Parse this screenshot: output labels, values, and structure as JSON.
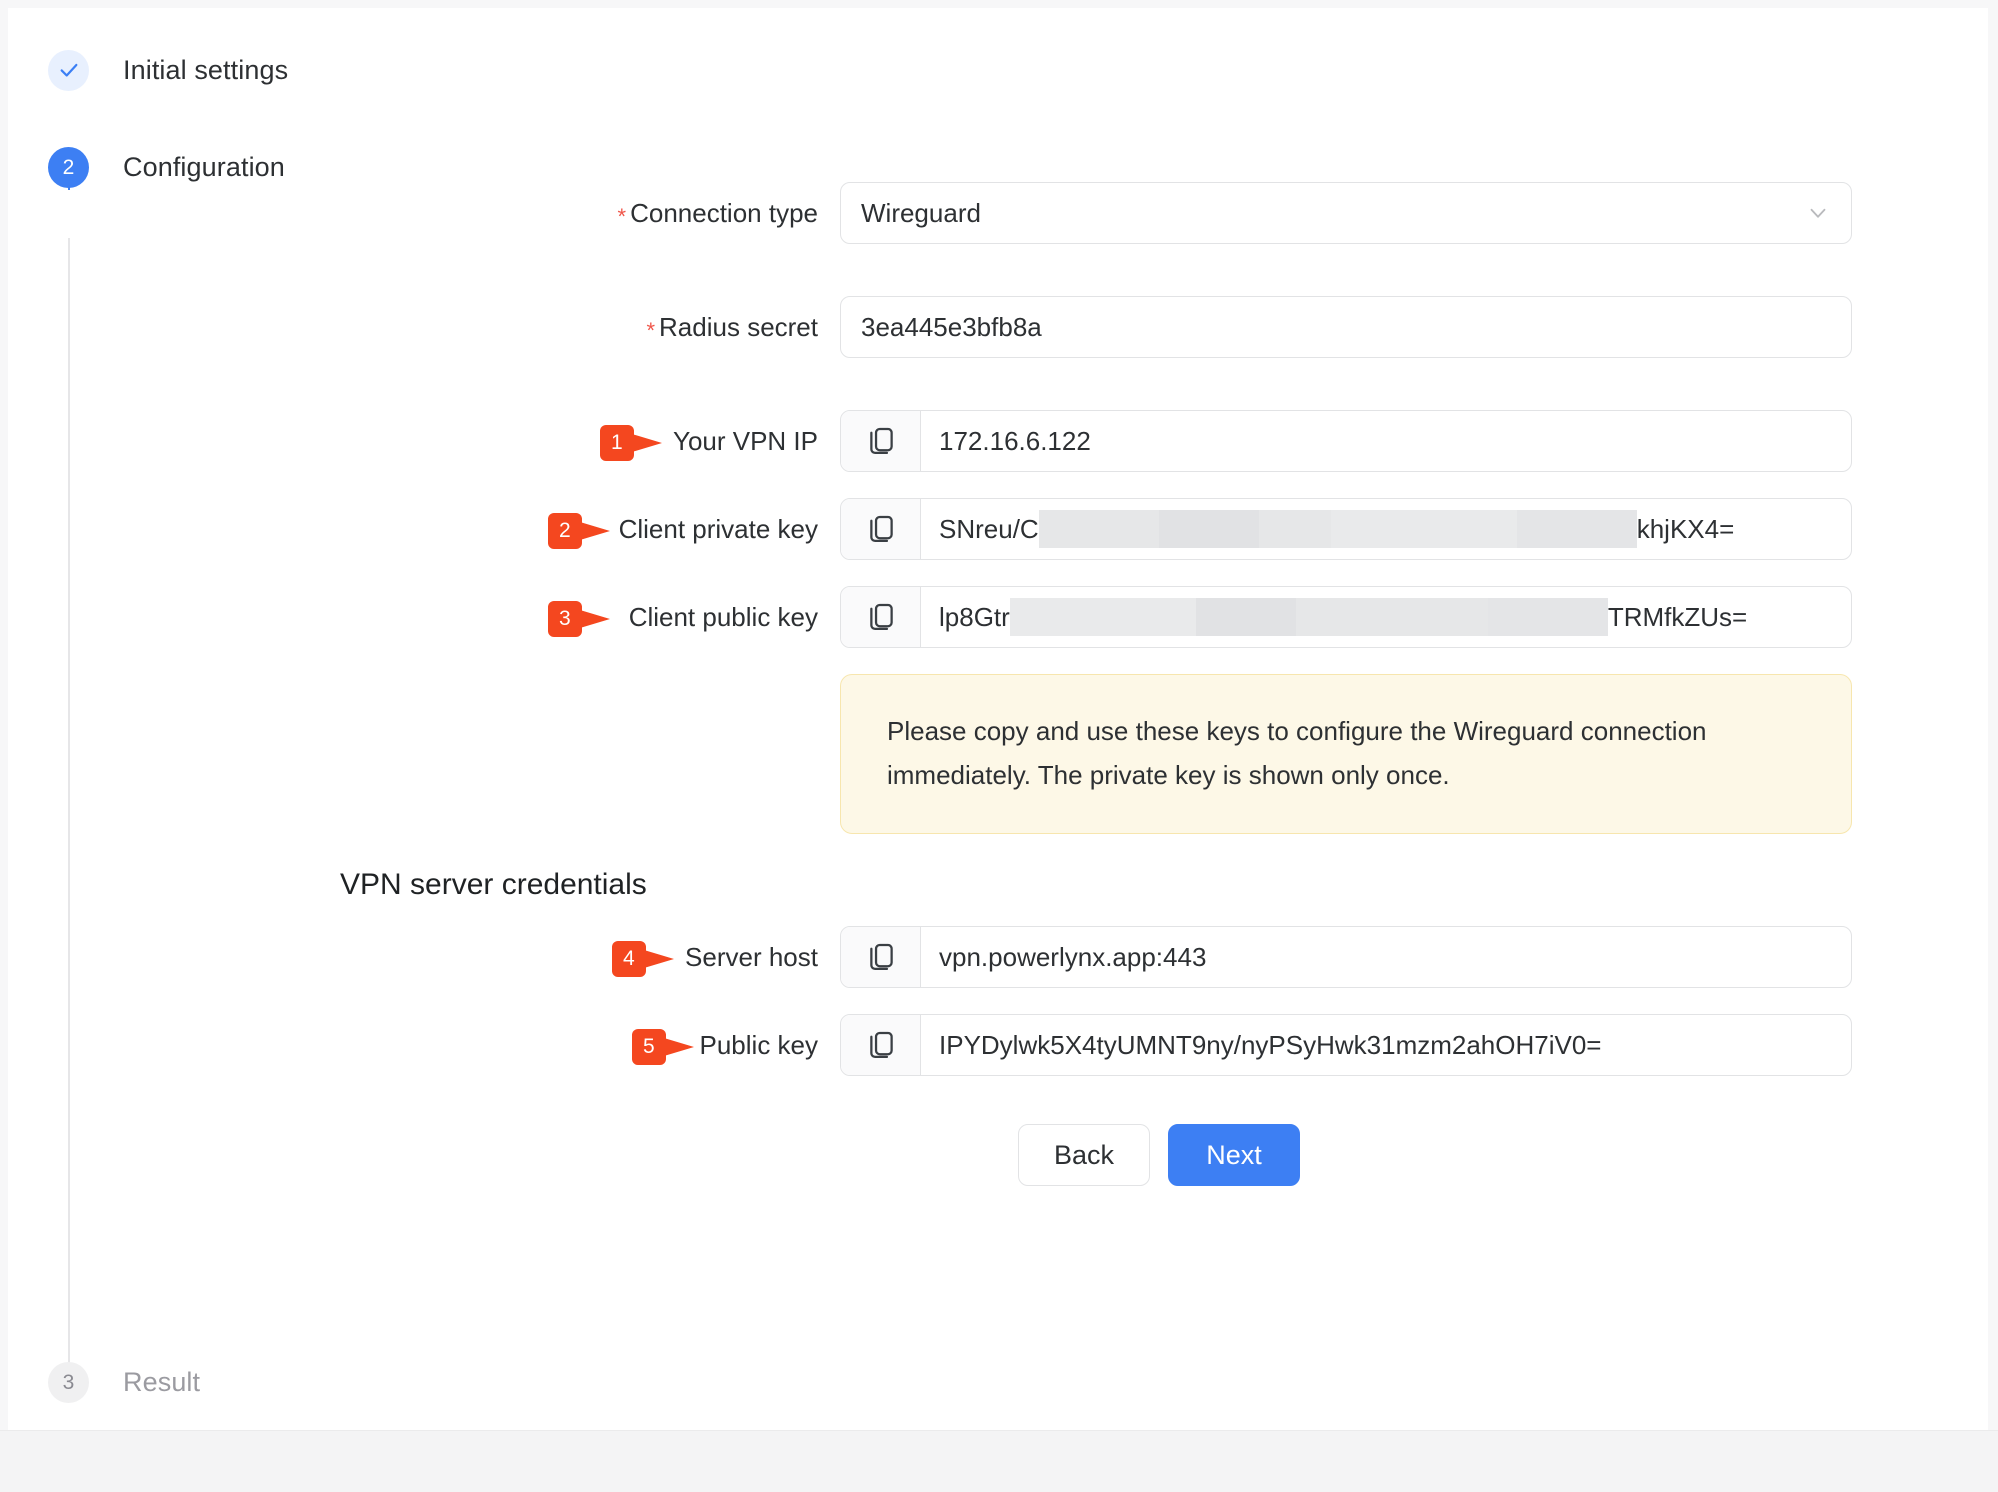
{
  "stepper": {
    "steps": [
      {
        "id": "initial-settings",
        "indicator": "check",
        "label": "Initial settings",
        "state": "done"
      },
      {
        "id": "configuration",
        "indicator": "2",
        "label": "Configuration",
        "state": "active"
      },
      {
        "id": "result",
        "indicator": "3",
        "label": "Result",
        "state": "idle"
      }
    ]
  },
  "form": {
    "connection_type": {
      "label": "Connection type",
      "required_mark": "*",
      "value": "Wireguard",
      "chevron": "chevron-down-icon"
    },
    "radius_secret": {
      "label": "Radius secret",
      "required_mark": "*",
      "value": "3ea445e3bfb8a"
    },
    "vpn_ip": {
      "marker": "1",
      "label": "Your VPN IP",
      "copy_icon": "copy-icon",
      "value": "172.16.6.122"
    },
    "client_private_key": {
      "marker": "2",
      "label": "Client private key",
      "copy_icon": "copy-icon",
      "value_prefix": "SNreu/C",
      "value_suffix": "khjKX4=",
      "redacted": true
    },
    "client_public_key": {
      "marker": "3",
      "label": "Client public key",
      "copy_icon": "copy-icon",
      "value_prefix": "lp8Gtr",
      "value_suffix": "TRMfkZUs=",
      "redacted": true
    }
  },
  "notice": {
    "text": "Please copy and use these keys to configure the Wireguard connection immediately. The private key is shown only once."
  },
  "server_section": {
    "title": "VPN server credentials",
    "server_host": {
      "marker": "4",
      "label": "Server host",
      "copy_icon": "copy-icon",
      "value": "vpn.powerlynx.app:443"
    },
    "public_key": {
      "marker": "5",
      "label": "Public key",
      "copy_icon": "copy-icon",
      "value": "IPYDylwk5X4tyUMNT9ny/nyPSyHwk31mzm2ahOH7iV0="
    }
  },
  "footer": {
    "back_label": "Back",
    "next_label": "Next"
  },
  "colors": {
    "accent_blue": "#3d7ff3",
    "marker_red": "#f4471f",
    "required_red": "#f0564a",
    "notice_bg": "#fdf8e7",
    "notice_border": "#f7e6ae"
  }
}
